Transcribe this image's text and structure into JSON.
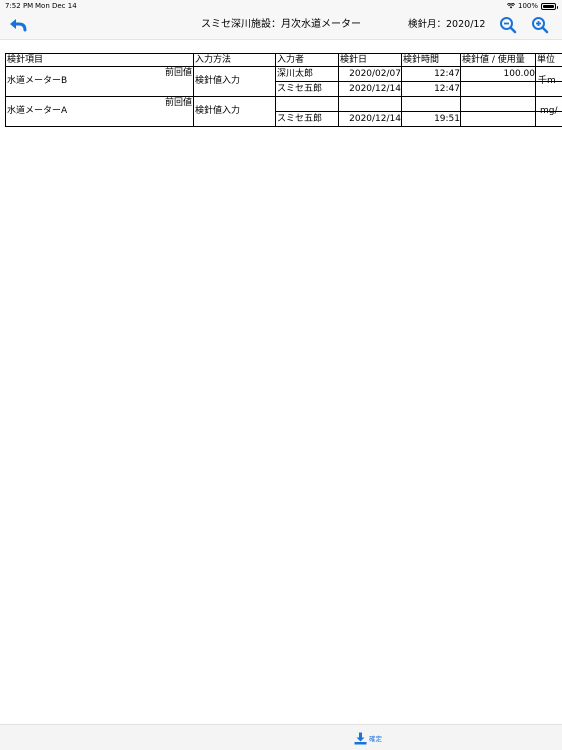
{
  "status_bar": {
    "time": "7:52 PM",
    "date": "Mon Dec 14",
    "battery": "100%"
  },
  "nav": {
    "title": "スミセ深川施設：月次水道メーター",
    "month_label": "検針月：",
    "month_value": "2020/12",
    "back_icon": "back-arrow-icon",
    "zoom_out_icon": "zoom-out-icon",
    "zoom_in_icon": "zoom-in-icon",
    "accent_color": "#1a73d9"
  },
  "table": {
    "headers": [
      "検針項目",
      "入力方法",
      "入力者",
      "検針日",
      "検針時間",
      "検針値 / 使用量",
      "単位"
    ],
    "rows": [
      {
        "item": "水道メーターB",
        "prev_label": "前回値",
        "method": "検針値入力",
        "unit": "千m",
        "sub": [
          {
            "inputter": "深川太郎",
            "date": "2020/02/07",
            "time": "12:47",
            "value": "100.00"
          },
          {
            "inputter": "スミセ五郎",
            "date": "2020/12/14",
            "time": "12:47",
            "value": ""
          }
        ]
      },
      {
        "item": "水道メーターA",
        "prev_label": "前回値",
        "method": "検針値入力",
        "unit": "mg/",
        "sub": [
          {
            "inputter": "",
            "date": "",
            "time": "",
            "value": ""
          },
          {
            "inputter": "スミセ五郎",
            "date": "2020/12/14",
            "time": "19:51",
            "value": ""
          }
        ]
      }
    ]
  },
  "footer": {
    "confirm_label": "確定",
    "confirm_icon": "download-icon"
  }
}
